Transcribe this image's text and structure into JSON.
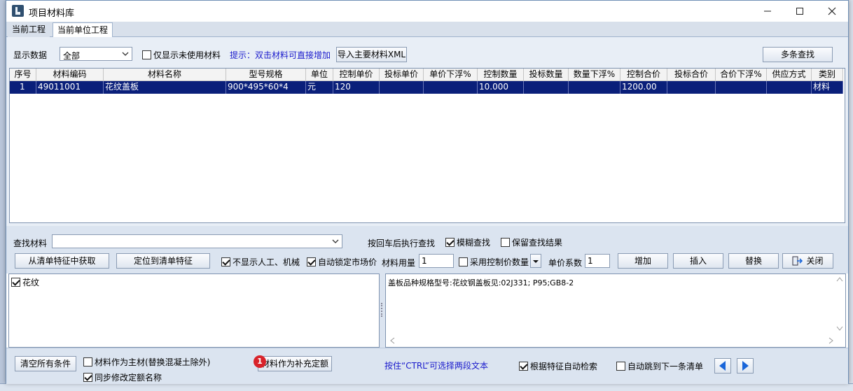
{
  "window": {
    "title": "项目材料库"
  },
  "tabs": [
    {
      "label": "当前工程"
    },
    {
      "label": "当前单位工程"
    }
  ],
  "toolbar": {
    "display_label": "显示数据",
    "display_value": "全部",
    "only_unused_label": "仅显示未使用材料",
    "hint": "提示：双击材料可直接增加",
    "import_button": "导入主要材料XML",
    "multi_search_button": "多条查找"
  },
  "table": {
    "columns": [
      "序号",
      "材料编码",
      "材料名称",
      "型号规格",
      "单位",
      "控制单价",
      "投标单价",
      "单价下浮%",
      "控制数量",
      "投标数量",
      "数量下浮%",
      "控制合价",
      "投标合价",
      "合价下浮%",
      "供应方式",
      "类别"
    ],
    "rows": [
      [
        "1",
        "49011001",
        "花纹盖板",
        "900*495*60*4",
        "元",
        "120",
        "",
        "",
        "10.000",
        "",
        "",
        "1200.00",
        "",
        "",
        "",
        "材料"
      ]
    ]
  },
  "search": {
    "find_label": "查找材料",
    "find_value": "",
    "enter_exec_label": "按回车后执行查找",
    "fuzzy_label": "模糊查找",
    "keep_result_label": "保留查找结果",
    "from_feature_button": "从清单特征中获取",
    "locate_feature_button": "定位到清单特征",
    "hide_labor_label": "不显示人工、机械",
    "auto_lock_label": "自动锁定市场价",
    "usage_label": "材料用量",
    "usage_value": "1",
    "use_control_price_label": "采用控制价数量",
    "unit_price_factor_label": "单价系数",
    "unit_price_factor_value": "1",
    "add_button": "增加",
    "insert_button": "插入",
    "replace_button": "替换",
    "close_button": "关闭"
  },
  "tree": {
    "items": [
      {
        "label": "花纹",
        "checked": true
      }
    ]
  },
  "description": {
    "text": "盖板品种规格型号:花纹钢盖板见:02J331; P95;GB8-2"
  },
  "bottom": {
    "clear_button": "清空所有条件",
    "as_main_label": "材料作为主材(替换混凝土除外)",
    "sync_name_label": "同步修改定额名称",
    "supplement_button": "材料作为补充定额",
    "badge": "1",
    "ctrl_hint": "按住“CTRL”可选择两段文本",
    "auto_search_label": "根据特征自动检索",
    "auto_jump_label": "自动跳到下一条清单"
  },
  "colors": {
    "selected_row": "#0a1f7a",
    "hint_text": "#1a1acc",
    "nav_arrow": "#1a66d9",
    "badge": "#d8232a"
  }
}
